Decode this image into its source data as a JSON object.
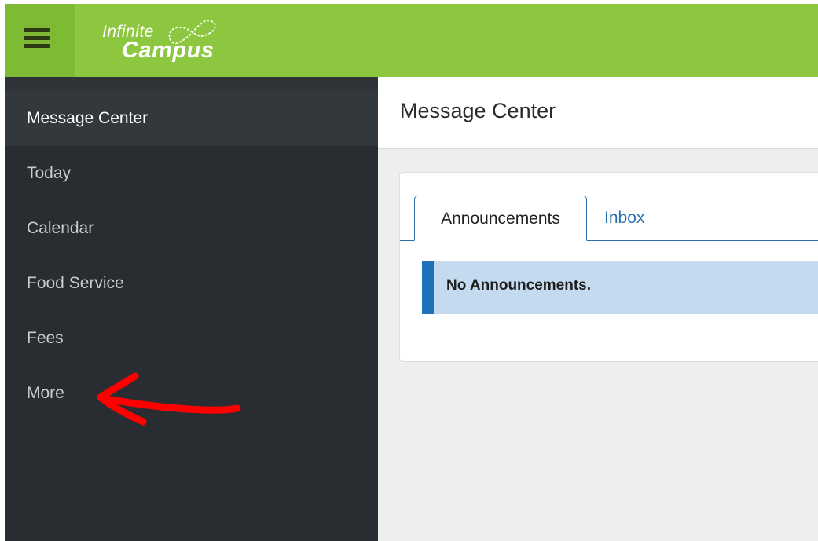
{
  "app": {
    "logo_line1": "Infinite",
    "logo_line2": "Campus",
    "brand_color": "#8dc63f"
  },
  "header": {
    "menu_icon": "hamburger-menu-icon"
  },
  "sidebar": {
    "items": [
      {
        "label": "Message Center",
        "active": true
      },
      {
        "label": "Today",
        "active": false
      },
      {
        "label": "Calendar",
        "active": false
      },
      {
        "label": "Food Service",
        "active": false
      },
      {
        "label": "Fees",
        "active": false
      },
      {
        "label": "More",
        "active": false
      }
    ]
  },
  "main": {
    "title": "Message Center",
    "tabs": [
      {
        "label": "Announcements",
        "active": true
      },
      {
        "label": "Inbox",
        "active": false
      }
    ],
    "alert_text": "No Announcements.",
    "alert_color": "#c4dbef",
    "accent_color": "#1d71b8"
  },
  "annotation": {
    "type": "red-arrow",
    "color": "#ff0000",
    "points_to": "More"
  }
}
